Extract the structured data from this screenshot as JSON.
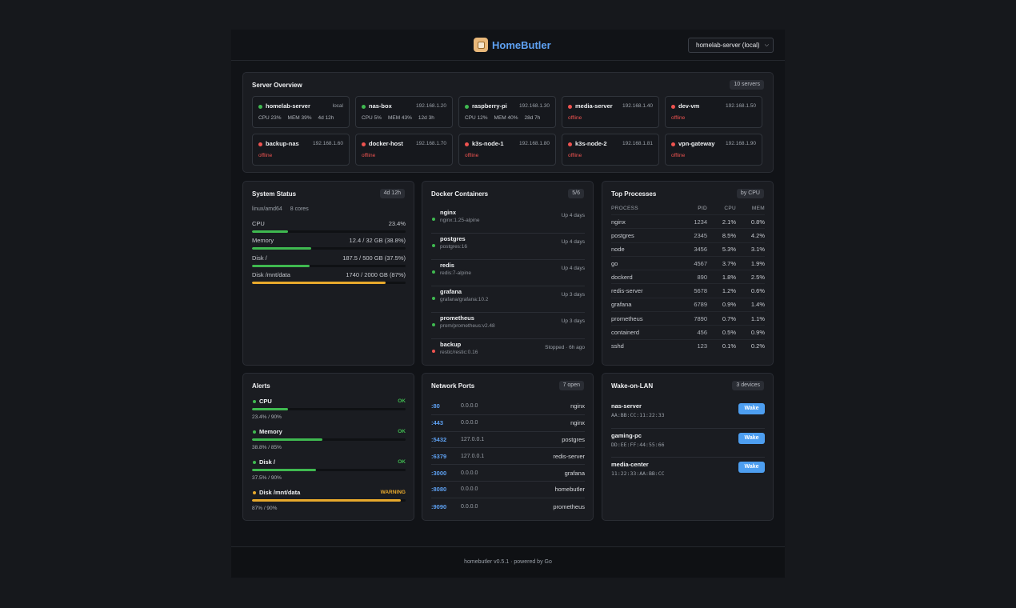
{
  "app": {
    "name": "HomeButler",
    "server_select": "homelab-server (local)"
  },
  "overview": {
    "title": "Server Overview",
    "badge": "10 servers",
    "servers": [
      {
        "name": "homelab-server",
        "ip": "local",
        "status": "online",
        "cpu": "CPU 23%",
        "mem": "MEM 39%",
        "uptime": "4d 12h"
      },
      {
        "name": "nas-box",
        "ip": "192.168.1.20",
        "status": "online",
        "cpu": "CPU 5%",
        "mem": "MEM 43%",
        "uptime": "12d 3h"
      },
      {
        "name": "raspberry-pi",
        "ip": "192.168.1.30",
        "status": "online",
        "cpu": "CPU 12%",
        "mem": "MEM 40%",
        "uptime": "28d 7h"
      },
      {
        "name": "media-server",
        "ip": "192.168.1.40",
        "status": "offline",
        "offline_label": "offline"
      },
      {
        "name": "dev-vm",
        "ip": "192.168.1.50",
        "status": "offline",
        "offline_label": "offline"
      },
      {
        "name": "backup-nas",
        "ip": "192.168.1.60",
        "status": "offline",
        "offline_label": "offline"
      },
      {
        "name": "docker-host",
        "ip": "192.168.1.70",
        "status": "offline",
        "offline_label": "offline"
      },
      {
        "name": "k3s-node-1",
        "ip": "192.168.1.80",
        "status": "offline",
        "offline_label": "offline"
      },
      {
        "name": "k3s-node-2",
        "ip": "192.168.1.81",
        "status": "offline",
        "offline_label": "offline"
      },
      {
        "name": "vpn-gateway",
        "ip": "192.168.1.90",
        "status": "offline",
        "offline_label": "offline"
      }
    ]
  },
  "system": {
    "title": "System Status",
    "badge": "4d 12h",
    "arch": "linux/amd64",
    "cores": "8 cores",
    "meters": [
      {
        "label": "CPU",
        "value": "23.4%",
        "percent": 23.4,
        "color": "#3fb950"
      },
      {
        "label": "Memory",
        "value": "12.4 / 32 GB (38.8%)",
        "percent": 38.8,
        "color": "#3fb950"
      },
      {
        "label": "Disk /",
        "value": "187.5 / 500 GB (37.5%)",
        "percent": 37.5,
        "color": "#3fb950"
      },
      {
        "label": "Disk /mnt/data",
        "value": "1740 / 2000 GB (87%)",
        "percent": 87,
        "color": "#e8a92c"
      }
    ]
  },
  "docker": {
    "title": "Docker Containers",
    "badge": "5/6",
    "containers": [
      {
        "name": "nginx",
        "image": "nginx:1.25-alpine",
        "status": "Up 4 days",
        "running": true
      },
      {
        "name": "postgres",
        "image": "postgres:16",
        "status": "Up 4 days",
        "running": true
      },
      {
        "name": "redis",
        "image": "redis:7-alpine",
        "status": "Up 4 days",
        "running": true
      },
      {
        "name": "grafana",
        "image": "grafana/grafana:10.2",
        "status": "Up 3 days",
        "running": true
      },
      {
        "name": "prometheus",
        "image": "prom/prometheus:v2.48",
        "status": "Up 3 days",
        "running": true
      },
      {
        "name": "backup",
        "image": "restic/restic:0.16",
        "status": "Stopped · 6h ago",
        "running": false
      }
    ]
  },
  "processes": {
    "title": "Top Processes",
    "badge": "by CPU",
    "headers": {
      "process": "PROCESS",
      "pid": "PID",
      "cpu": "CPU",
      "mem": "MEM"
    },
    "rows": [
      {
        "name": "nginx",
        "pid": "1234",
        "cpu": "2.1%",
        "mem": "0.8%"
      },
      {
        "name": "postgres",
        "pid": "2345",
        "cpu": "8.5%",
        "mem": "4.2%"
      },
      {
        "name": "node",
        "pid": "3456",
        "cpu": "5.3%",
        "mem": "3.1%"
      },
      {
        "name": "go",
        "pid": "4567",
        "cpu": "3.7%",
        "mem": "1.9%"
      },
      {
        "name": "dockerd",
        "pid": "890",
        "cpu": "1.8%",
        "mem": "2.5%"
      },
      {
        "name": "redis-server",
        "pid": "5678",
        "cpu": "1.2%",
        "mem": "0.6%"
      },
      {
        "name": "grafana",
        "pid": "6789",
        "cpu": "0.9%",
        "mem": "1.4%"
      },
      {
        "name": "prometheus",
        "pid": "7890",
        "cpu": "0.7%",
        "mem": "1.1%"
      },
      {
        "name": "containerd",
        "pid": "456",
        "cpu": "0.5%",
        "mem": "0.9%"
      },
      {
        "name": "sshd",
        "pid": "123",
        "cpu": "0.1%",
        "mem": "0.2%"
      }
    ]
  },
  "alerts": {
    "title": "Alerts",
    "items": [
      {
        "name": "CPU",
        "state": "OK",
        "value": "23.4% / 90%",
        "percent": 23.4,
        "color": "#3fb950"
      },
      {
        "name": "Memory",
        "state": "OK",
        "value": "38.8% / 85%",
        "percent": 45.6,
        "color": "#3fb950"
      },
      {
        "name": "Disk /",
        "state": "OK",
        "value": "37.5% / 90%",
        "percent": 41.7,
        "color": "#3fb950"
      },
      {
        "name": "Disk /mnt/data",
        "state": "WARNING",
        "value": "87% / 90%",
        "percent": 96.7,
        "color": "#e8a92c"
      }
    ]
  },
  "ports": {
    "title": "Network Ports",
    "badge": "7 open",
    "rows": [
      {
        "port": ":80",
        "addr": "0.0.0.0",
        "process": "nginx"
      },
      {
        "port": ":443",
        "addr": "0.0.0.0",
        "process": "nginx"
      },
      {
        "port": ":5432",
        "addr": "127.0.0.1",
        "process": "postgres"
      },
      {
        "port": ":6379",
        "addr": "127.0.0.1",
        "process": "redis-server"
      },
      {
        "port": ":3000",
        "addr": "0.0.0.0",
        "process": "grafana"
      },
      {
        "port": ":8080",
        "addr": "0.0.0.0",
        "process": "homebutler"
      },
      {
        "port": ":9090",
        "addr": "0.0.0.0",
        "process": "prometheus"
      }
    ]
  },
  "wol": {
    "title": "Wake-on-LAN",
    "badge": "3 devices",
    "button_label": "Wake",
    "devices": [
      {
        "name": "nas-server",
        "mac": "AA:BB:CC:11:22:33"
      },
      {
        "name": "gaming-pc",
        "mac": "DD:EE:FF:44:55:66"
      },
      {
        "name": "media-center",
        "mac": "11:22:33:AA:BB:CC"
      }
    ]
  },
  "footer": {
    "text": "homebutler v0.5.1 · powered by Go"
  },
  "colors": {
    "ok": "#3fb950",
    "error": "#ef5350",
    "warning": "#e8a92c",
    "accent": "#5ea1f2"
  }
}
